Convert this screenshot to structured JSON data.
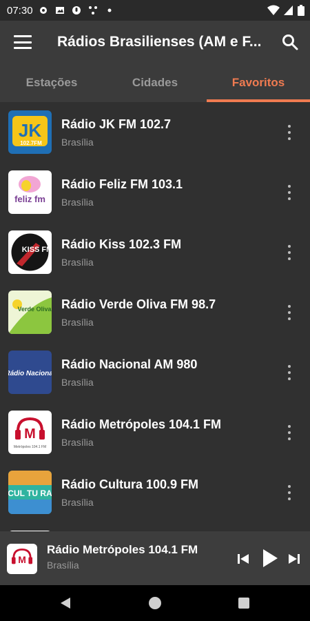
{
  "status_bar": {
    "time": "07:30"
  },
  "app_bar": {
    "title": "Rádios Brasilienses (AM e F..."
  },
  "tabs": [
    {
      "label": "Estações",
      "active": false
    },
    {
      "label": "Cidades",
      "active": false
    },
    {
      "label": "Favoritos",
      "active": true
    }
  ],
  "stations": [
    {
      "name": "Rádio JK FM 102.7",
      "city": "Brasília",
      "logo_text": "JK",
      "logo_subtext": "102.7FM"
    },
    {
      "name": "Rádio Feliz FM 103.1",
      "city": "Brasília",
      "logo_text": "feliz fm"
    },
    {
      "name": "Rádio Kiss 102.3 FM",
      "city": "Brasília",
      "logo_text": "KISS FM"
    },
    {
      "name": "Rádio Verde Oliva FM 98.7",
      "city": "Brasília",
      "logo_text": "Verde Oliva"
    },
    {
      "name": "Rádio Nacional AM 980",
      "city": "Brasília",
      "logo_text": "Rádio Nacional"
    },
    {
      "name": "Rádio Metrópoles 104.1 FM",
      "city": "Brasília",
      "logo_text": "Metrópoles 104.1 FM"
    },
    {
      "name": "Rádio Cultura 100.9 FM",
      "city": "Brasília",
      "logo_text": "CUL TU RA"
    }
  ],
  "player": {
    "title": "Rádio Metrópoles 104.1 FM",
    "subtitle": "Brasília"
  },
  "colors": {
    "accent": "#f07b51",
    "background": "#303030",
    "app_bar": "#3b3b3b"
  }
}
